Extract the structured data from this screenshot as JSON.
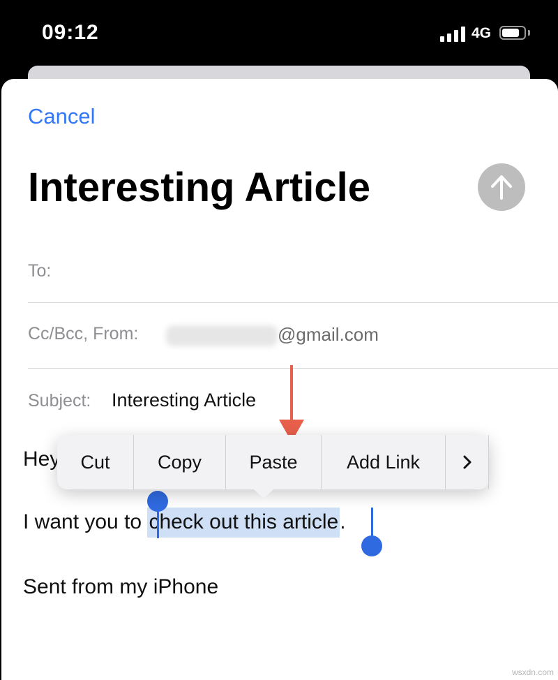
{
  "status_bar": {
    "time": "09:12",
    "network": "4G",
    "icons": [
      "signal-bars-icon",
      "battery-icon"
    ]
  },
  "compose": {
    "cancel_label": "Cancel",
    "title": "Interesting Article",
    "send_icon": "arrow-up-icon",
    "to_label": "To:",
    "cc_from_label": "Cc/Bcc, From:",
    "from_domain": "@gmail.com",
    "subject_label": "Subject:",
    "subject_value": "Interesting Article"
  },
  "body": {
    "greeting_partial": "Hey",
    "line2_prefix": "I want you to ",
    "line2_selected": "check out this article",
    "line2_suffix": ".",
    "signature": "Sent from my iPhone"
  },
  "context_menu": {
    "items": [
      "Cut",
      "Copy",
      "Paste",
      "Add Link"
    ],
    "more_icon": "chevron-right-icon"
  },
  "annotation": {
    "arrow_color": "#e8604c"
  },
  "colors": {
    "accent": "#3478f6",
    "selection": "#cfdff5",
    "handle": "#2f6ae0"
  },
  "watermark": "wsxdn.com"
}
